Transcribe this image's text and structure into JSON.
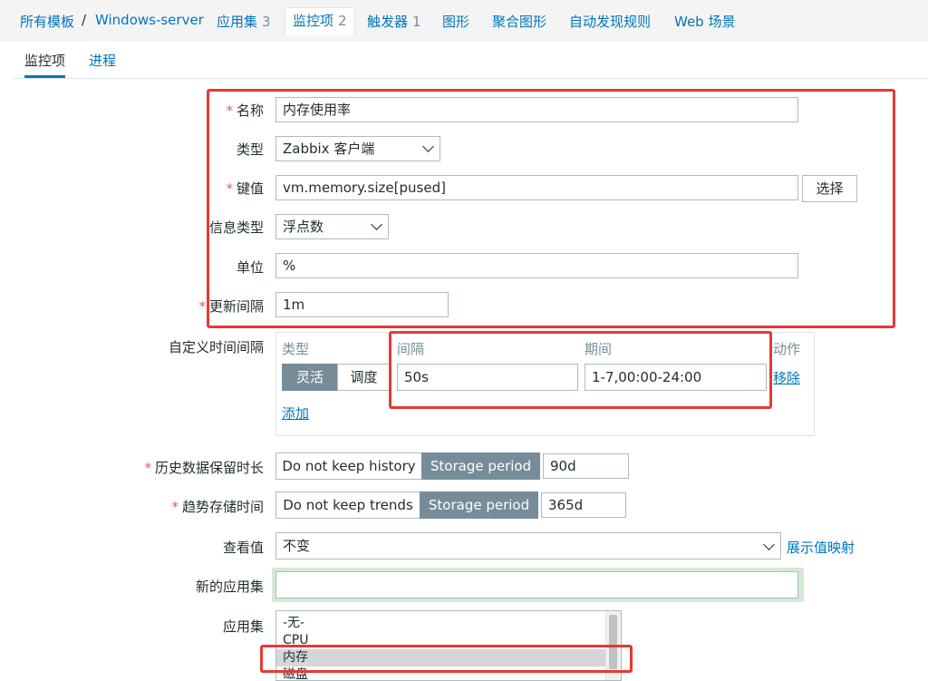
{
  "breadcrumb": {
    "all_templates": "所有模板",
    "separator": "/",
    "host": "Windows-server"
  },
  "nav": {
    "apps": {
      "label": "应用集",
      "count": "3"
    },
    "items": {
      "label": "监控项",
      "count": "2"
    },
    "triggers": {
      "label": "触发器",
      "count": "1"
    },
    "graphs": {
      "label": "图形"
    },
    "screens": {
      "label": "聚合图形"
    },
    "discovery": {
      "label": "自动发现规则"
    },
    "web": {
      "label": "Web 场景"
    }
  },
  "tabs": {
    "item": "监控项",
    "process": "进程"
  },
  "form": {
    "name": {
      "label": "名称",
      "value": "内存使用率"
    },
    "type": {
      "label": "类型",
      "value": "Zabbix 客户端"
    },
    "key": {
      "label": "键值",
      "value": "vm.memory.size[pused]",
      "select_button": "选择"
    },
    "info_type": {
      "label": "信息类型",
      "value": "浮点数"
    },
    "units": {
      "label": "单位",
      "value": "%"
    },
    "update_interval": {
      "label": "更新间隔",
      "value": "1m"
    },
    "custom_intervals": {
      "label": "自定义时间间隔",
      "col_type": "类型",
      "col_interval": "间隔",
      "col_period": "期间",
      "col_action": "动作",
      "flexible": "灵活",
      "scheduling": "调度",
      "interval_value": "50s",
      "period_value": "1-7,00:00-24:00",
      "remove": "移除",
      "add": "添加"
    },
    "history": {
      "label": "历史数据保留时长",
      "no_keep": "Do not keep history",
      "storage": "Storage period",
      "value": "90d"
    },
    "trends": {
      "label": "趋势存储时间",
      "no_keep": "Do not keep trends",
      "storage": "Storage period",
      "value": "365d"
    },
    "valuemap": {
      "label": "查看值",
      "value": "不变",
      "link": "展示值映射"
    },
    "new_app": {
      "label": "新的应用集",
      "value": ""
    },
    "apps": {
      "label": "应用集",
      "options": [
        "-无-",
        "CPU",
        "内存",
        "磁盘"
      ],
      "selected": "内存"
    }
  },
  "colors": {
    "accent": "#0275b8",
    "highlight": "#e53935",
    "segment_active": "#768d99"
  }
}
